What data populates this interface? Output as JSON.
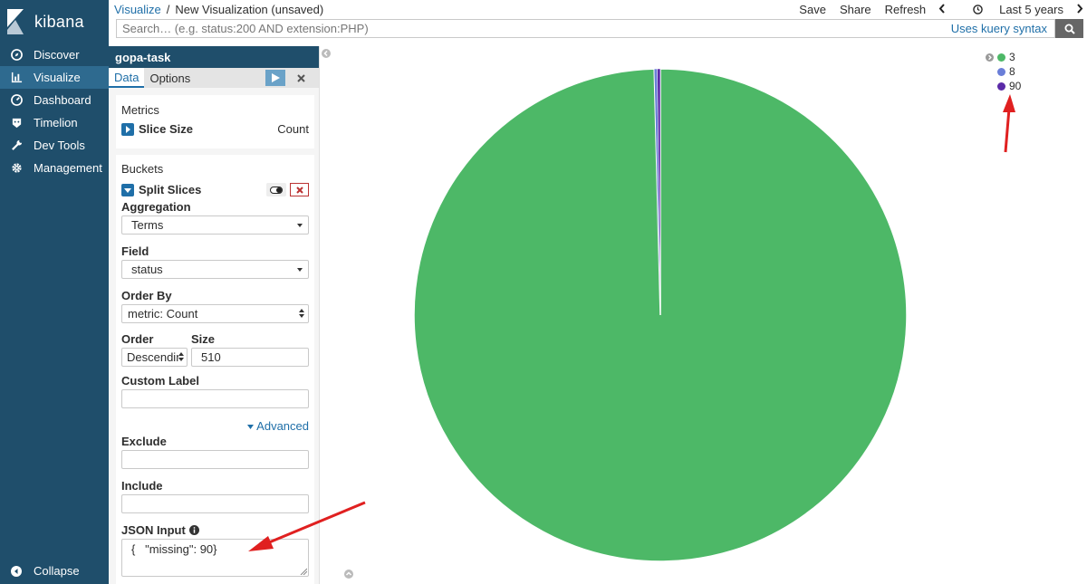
{
  "app": {
    "name": "kibana"
  },
  "nav": {
    "items": [
      {
        "label": "Discover",
        "icon": "compass-icon",
        "active": false
      },
      {
        "label": "Visualize",
        "icon": "bar-chart-icon",
        "active": true
      },
      {
        "label": "Dashboard",
        "icon": "dashboard-icon",
        "active": false
      },
      {
        "label": "Timelion",
        "icon": "timelion-icon",
        "active": false
      },
      {
        "label": "Dev Tools",
        "icon": "wrench-icon",
        "active": false
      },
      {
        "label": "Management",
        "icon": "gear-icon",
        "active": false
      }
    ],
    "collapse_label": "Collapse"
  },
  "breadcrumb": {
    "parent": "Visualize",
    "separator": "/",
    "current": "New Visualization (unsaved)"
  },
  "toolbar": {
    "save": "Save",
    "share": "Share",
    "refresh": "Refresh",
    "time_range": "Last 5 years"
  },
  "search": {
    "placeholder": "Search… (e.g. status:200 AND extension:PHP)",
    "kuery_link": "Uses kuery syntax"
  },
  "editor": {
    "index_name": "gopa-task",
    "tabs": [
      {
        "label": "Data",
        "active": true
      },
      {
        "label": "Options",
        "active": false
      }
    ],
    "metrics": {
      "header": "Metrics",
      "agg_label": "Slice Size",
      "agg_value": "Count"
    },
    "buckets": {
      "header": "Buckets",
      "agg_label": "Split Slices",
      "aggregation": {
        "label": "Aggregation",
        "value": "Terms"
      },
      "field": {
        "label": "Field",
        "value": "status"
      },
      "order_by": {
        "label": "Order By",
        "value": "metric: Count"
      },
      "order": {
        "label": "Order",
        "value": "Descending"
      },
      "size": {
        "label": "Size",
        "value": "510"
      },
      "custom_label": {
        "label": "Custom Label",
        "value": ""
      },
      "advanced_link": "Advanced",
      "exclude": {
        "label": "Exclude",
        "value": ""
      },
      "include": {
        "label": "Include",
        "value": ""
      },
      "json_input": {
        "label": "JSON Input",
        "value": "{   \"missing\": 90}"
      }
    }
  },
  "colors": {
    "nav_bg": "#1f4e6b",
    "nav_active": "#2e6a8f",
    "pie_green": "#4db867",
    "link": "#1f6fa8"
  },
  "chart_data": {
    "type": "pie",
    "categories": [
      "3",
      "8",
      "90"
    ],
    "values": [
      99.6,
      0.2,
      0.2
    ],
    "colors": [
      "#4db867",
      "#6a7ed8",
      "#5b2aa8"
    ],
    "legend": "top-right"
  }
}
